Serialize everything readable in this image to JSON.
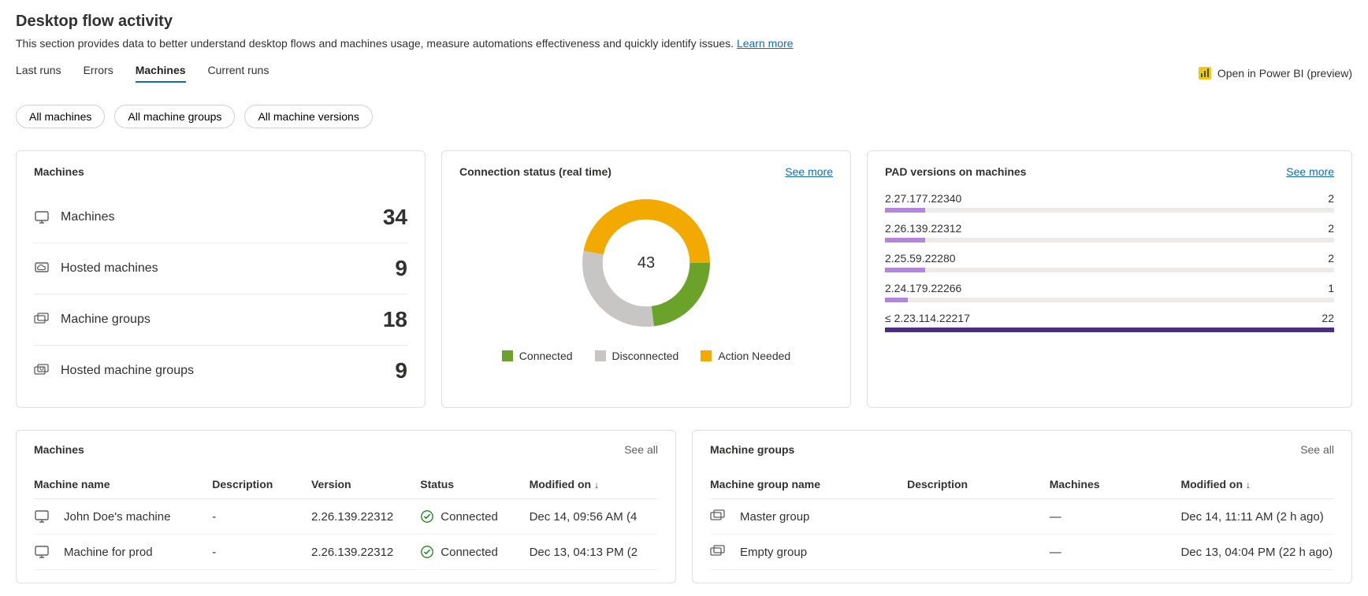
{
  "header": {
    "title": "Desktop flow activity",
    "subtitle": "This section provides data to better understand desktop flows and machines usage, measure automations effectiveness and quickly identify issues.",
    "learn_more": "Learn more"
  },
  "tabs": {
    "items": [
      {
        "label": "Last runs",
        "active": false
      },
      {
        "label": "Errors",
        "active": false
      },
      {
        "label": "Machines",
        "active": true
      },
      {
        "label": "Current runs",
        "active": false
      }
    ],
    "powerbi_label": "Open in Power BI (preview)"
  },
  "filters": {
    "items": [
      {
        "label": "All machines"
      },
      {
        "label": "All machine groups"
      },
      {
        "label": "All machine versions"
      }
    ]
  },
  "machines_card": {
    "title": "Machines",
    "stats": [
      {
        "icon": "desktop-icon",
        "label": "Machines",
        "value": "34"
      },
      {
        "icon": "hosted-desktop-icon",
        "label": "Hosted machines",
        "value": "9"
      },
      {
        "icon": "desktop-group-icon",
        "label": "Machine groups",
        "value": "18"
      },
      {
        "icon": "hosted-group-icon",
        "label": "Hosted machine groups",
        "value": "9"
      }
    ]
  },
  "connection_card": {
    "title": "Connection status (real time)",
    "see_more": "See more",
    "center": "43",
    "legend": [
      {
        "label": "Connected",
        "color": "#6BA22A"
      },
      {
        "label": "Disconnected",
        "color": "#C8C6C4"
      },
      {
        "label": "Action Needed",
        "color": "#F2A900"
      }
    ]
  },
  "versions_card": {
    "title": "PAD versions on machines",
    "see_more": "See more",
    "rows": [
      {
        "label": "2.27.177.22340",
        "value": "2",
        "width": "9%",
        "color": "#B584DC"
      },
      {
        "label": "2.26.139.22312",
        "value": "2",
        "width": "9%",
        "color": "#B584DC"
      },
      {
        "label": "2.25.59.22280",
        "value": "2",
        "width": "9%",
        "color": "#B584DC"
      },
      {
        "label": "2.24.179.22266",
        "value": "1",
        "width": "5%",
        "color": "#B584DC"
      },
      {
        "label": "≤ 2.23.114.22217",
        "value": "22",
        "width": "100%",
        "color": "#4B2E83"
      }
    ]
  },
  "machines_table": {
    "title": "Machines",
    "see_all": "See all",
    "columns": {
      "name": "Machine name",
      "desc": "Description",
      "version": "Version",
      "status": "Status",
      "modified": "Modified on"
    },
    "rows": [
      {
        "name": "John Doe's machine",
        "desc": "-",
        "version": "2.26.139.22312",
        "status": "Connected",
        "modified": "Dec 14, 09:56 AM (4"
      },
      {
        "name": "Machine for prod",
        "desc": "-",
        "version": "2.26.139.22312",
        "status": "Connected",
        "modified": "Dec 13, 04:13 PM (2"
      }
    ]
  },
  "groups_table": {
    "title": "Machine groups",
    "see_all": "See all",
    "columns": {
      "name": "Machine group name",
      "desc": "Description",
      "machines": "Machines",
      "modified": "Modified on"
    },
    "rows": [
      {
        "name": "Master group",
        "desc": "",
        "machines": "—",
        "modified": "Dec 14, 11:11 AM (2 h ago)"
      },
      {
        "name": "Empty group",
        "desc": "",
        "machines": "—",
        "modified": "Dec 13, 04:04 PM (22 h ago)"
      }
    ]
  },
  "chart_data": {
    "type": "pie",
    "title": "Connection status (real time)",
    "total": 43,
    "series": [
      {
        "name": "Connected",
        "value": 10,
        "color": "#6BA22A"
      },
      {
        "name": "Disconnected",
        "value": 13,
        "color": "#C8C6C4"
      },
      {
        "name": "Action Needed",
        "value": 20,
        "color": "#F2A900"
      }
    ]
  }
}
